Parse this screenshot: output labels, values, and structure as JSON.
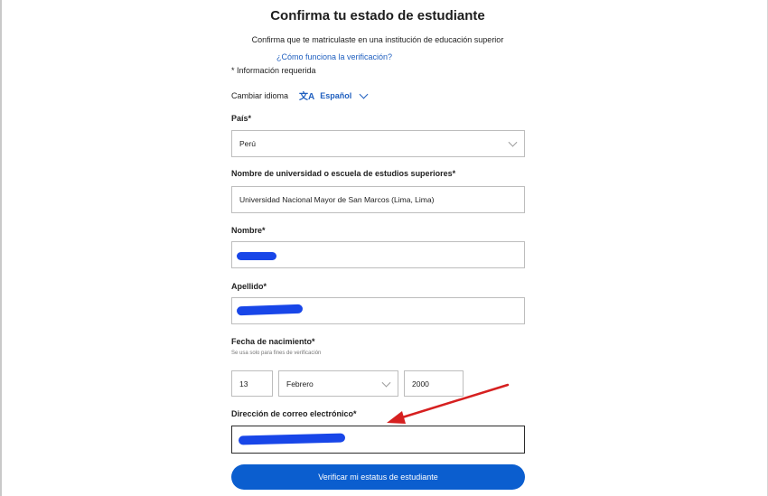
{
  "header": {
    "title": "Confirma tu estado de estudiante",
    "subtitle": "Confirma que te matriculaste en una institución de educación superior",
    "help_link": "¿Cómo funciona la verificación?"
  },
  "form": {
    "required_note": "* Información requerida",
    "language": {
      "label": "Cambiar idioma",
      "icon": "translate-icon",
      "icon_glyph": "文A",
      "value": "Español"
    },
    "country": {
      "label": "País*",
      "value": "Perú"
    },
    "university": {
      "label": "Nombre de universidad o escuela de estudios superiores*",
      "value": "Universidad Nacional Mayor de San Marcos (Lima, Lima)"
    },
    "first_name": {
      "label": "Nombre*",
      "value": ""
    },
    "last_name": {
      "label": "Apellido*",
      "value": ""
    },
    "birthdate": {
      "label": "Fecha de nacimiento*",
      "hint": "Se usa solo para fines de verificación",
      "day": "13",
      "month": "Febrero",
      "year": "2000"
    },
    "email": {
      "label": "Dirección de correo electrónico*",
      "value": ""
    },
    "submit_label": "Verificar mi estatus de estudiante"
  },
  "colors": {
    "accent": "#0b5ecf",
    "link": "#1f5fbf",
    "redaction": "#1846e8",
    "annotation_arrow": "#d62020"
  }
}
